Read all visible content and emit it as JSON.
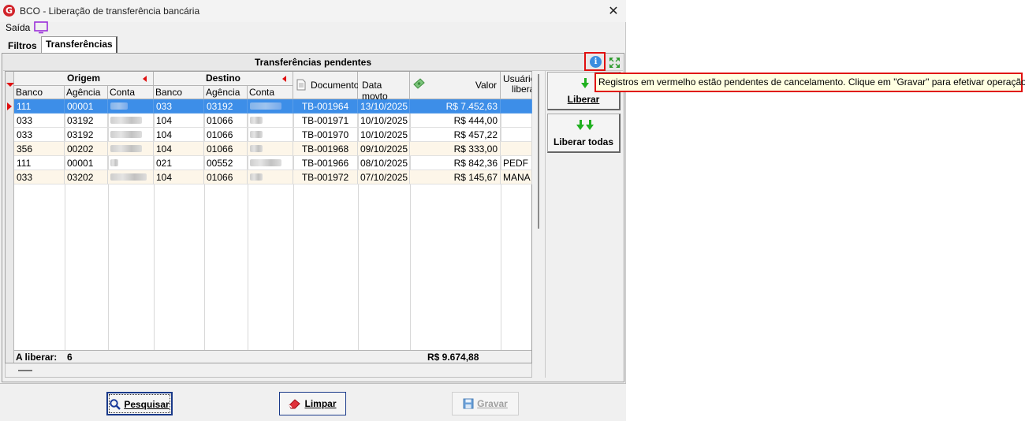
{
  "window": {
    "title": "BCO - Liberação de transferência bancária",
    "close": "✕",
    "app_logo": "G"
  },
  "menu": {
    "saida": "Saída",
    "monitor_icon": "monitor-icon"
  },
  "tabs": [
    {
      "label": "Filtros"
    },
    {
      "label": "Transferências"
    }
  ],
  "grid": {
    "caption": "Transferências pendentes",
    "groups": {
      "origem": "Origem",
      "destino": "Destino"
    },
    "columns": {
      "banco": "Banco",
      "agencia": "Agência",
      "conta": "Conta",
      "documento": "Documento",
      "data_movto": "Data movto",
      "valor": "Valor",
      "usuario_l1": "Usuário",
      "usuario_l2": "libera"
    },
    "rows": [
      {
        "ob": "111",
        "oa": "00001",
        "db": "033",
        "da": "03192",
        "doc": "TB-001964",
        "data": "13/10/2025",
        "valor": "R$ 7.452,63",
        "usuario": ""
      },
      {
        "ob": "033",
        "oa": "03192",
        "db": "104",
        "da": "01066",
        "doc": "TB-001971",
        "data": "10/10/2025",
        "valor": "R$ 444,00",
        "usuario": ""
      },
      {
        "ob": "033",
        "oa": "03192",
        "db": "104",
        "da": "01066",
        "doc": "TB-001970",
        "data": "10/10/2025",
        "valor": "R$ 457,22",
        "usuario": ""
      },
      {
        "ob": "356",
        "oa": "00202",
        "db": "104",
        "da": "01066",
        "doc": "TB-001968",
        "data": "09/10/2025",
        "valor": "R$ 333,00",
        "usuario": ""
      },
      {
        "ob": "111",
        "oa": "00001",
        "db": "021",
        "da": "00552",
        "doc": "TB-001966",
        "data": "08/10/2025",
        "valor": "R$ 842,36",
        "usuario": "PEDF"
      },
      {
        "ob": "033",
        "oa": "03202",
        "db": "104",
        "da": "01066",
        "doc": "TB-001972",
        "data": "07/10/2025",
        "valor": "R$ 145,67",
        "usuario": "MANA"
      }
    ],
    "footer": {
      "label": "A liberar:",
      "count": "6",
      "total": "R$ 9.674,88"
    }
  },
  "side_buttons": {
    "liberar": "Liberar",
    "liberar_todas": "Liberar todas"
  },
  "tooltip": "Registros em vermelho estão pendentes de cancelamento. Clique em \"Gravar\" para efetivar operação.",
  "bottom_buttons": {
    "pesquisar": "Pesquisar",
    "limpar": "Limpar",
    "gravar": "Gravar"
  },
  "colors": {
    "selection": "#3d8ee8",
    "highlight": "#e01010",
    "alt_row": "#fdf6e9"
  }
}
